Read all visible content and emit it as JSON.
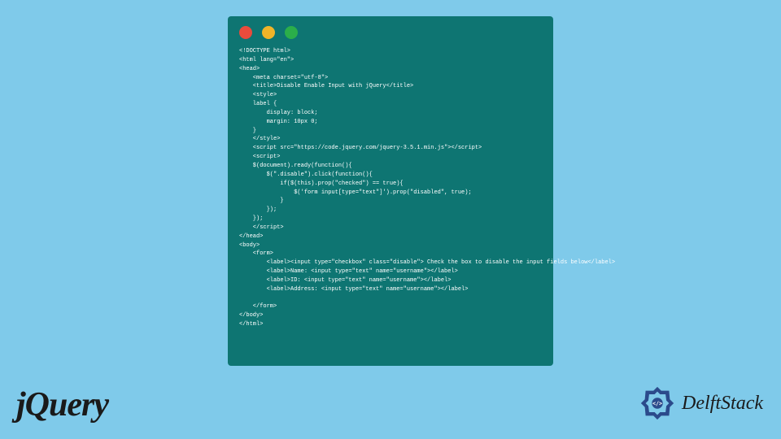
{
  "window": {
    "dot_colors": {
      "red": "#e94b3c",
      "yellow": "#f0b429",
      "green": "#2bae4a"
    },
    "bg": "#0e7572"
  },
  "code_lines": [
    "<!DOCTYPE html>",
    "<html lang=\"en\">",
    "<head>",
    "    <meta charset=\"utf-8\">",
    "    <title>Disable Enable Input with jQuery</title>",
    "    <style>",
    "    label {",
    "        display: block;",
    "        margin: 10px 0;",
    "    }",
    "    </style>",
    "    <script src=\"https://code.jquery.com/jquery-3.5.1.min.js\"></script>",
    "    <script>",
    "    $(document).ready(function(){",
    "        $(\".disable\").click(function(){",
    "            if($(this).prop(\"checked\") == true){",
    "                $('form input[type=\"text\"]').prop(\"disabled\", true);",
    "            }",
    "        });",
    "    });",
    "    </script>",
    "</head>",
    "<body>",
    "    <form>",
    "        <label><input type=\"checkbox\" class=\"disable\"> Check the box to disable the input fields below</label>",
    "        <label>Name: <input type=\"text\" name=\"username\"></label>",
    "        <label>ID: <input type=\"text\" name=\"username\"></label>",
    "        <label>Address: <input type=\"text\" name=\"username\"></label>",
    "",
    "    </form>",
    "</body>",
    "</html>"
  ],
  "logos": {
    "jquery": "jQuery",
    "delft": "DelftStack"
  },
  "page_bg": "#7fcaea"
}
